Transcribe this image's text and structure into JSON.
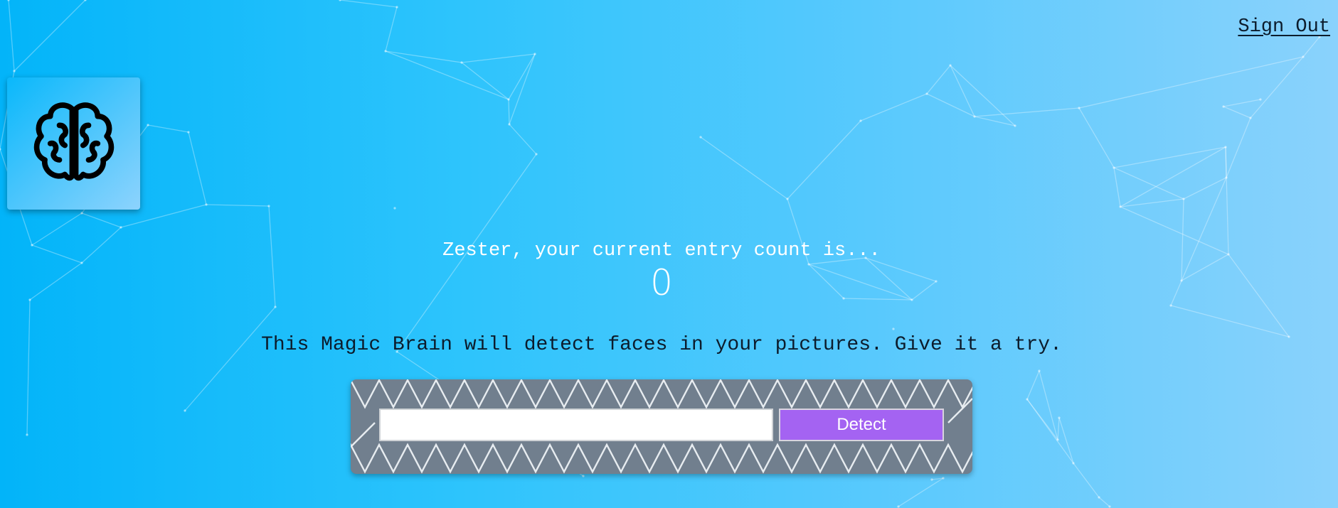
{
  "nav": {
    "sign_out_label": "Sign Out"
  },
  "logo": {
    "icon": "brain-icon"
  },
  "rank": {
    "message": "Zester, your current entry count is...",
    "entries": "0"
  },
  "intro": {
    "text": "This Magic Brain will detect faces in your pictures. Give it a try."
  },
  "image_form": {
    "url_value": "",
    "detect_label": "Detect"
  },
  "colors": {
    "background_start": "#02b4f9",
    "background_end": "#8ad2fc",
    "detect_button": "#a463f2",
    "form_panel": "#717f8e"
  }
}
